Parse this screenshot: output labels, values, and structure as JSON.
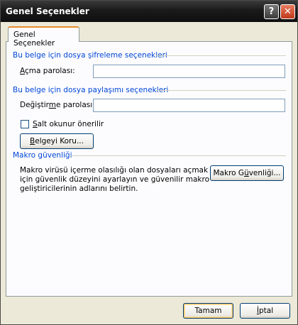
{
  "window": {
    "title": "Genel Seçenekler"
  },
  "titlebar": {
    "help_glyph": "?",
    "close_glyph": "✕"
  },
  "tabs": [
    {
      "label": "Genel Seçenekler"
    }
  ],
  "encryption": {
    "group_label": "Bu belge için dosya şifreleme seçenekleri",
    "open_password_label_pre": "",
    "open_password_label_ul": "A",
    "open_password_label_post": "çma parolası:",
    "open_password_value": ""
  },
  "sharing": {
    "group_label": "Bu belge için dosya paylaşımı seçenekleri",
    "modify_password_label_pre": "Değiştir",
    "modify_password_label_ul": "m",
    "modify_password_label_post": "e parolası:",
    "modify_password_value": "",
    "readonly_label_ul": "S",
    "readonly_label_post": "alt okunur önerilir",
    "readonly_checked": false,
    "protect_button_ul": "B",
    "protect_button_post": "elgeyi Koru..."
  },
  "macro": {
    "group_label": "Makro güvenliği",
    "description": "Makro virüsü içerme olasılığı olan dosyaları açmak için güvenlik düzeyini ayarlayın ve güvenilir makro geliştiricilerinin adlarını belirtin.",
    "button_pre": "Makro G",
    "button_ul": "ü",
    "button_post": "venliği..."
  },
  "footer": {
    "ok_label": "Tamam",
    "cancel_label_ul": "İ",
    "cancel_label_post": "ptal"
  },
  "colors": {
    "group_label": "#0046D5",
    "dialog_bg": "#ECE9D8",
    "tab_accent": "#E68B2C"
  }
}
